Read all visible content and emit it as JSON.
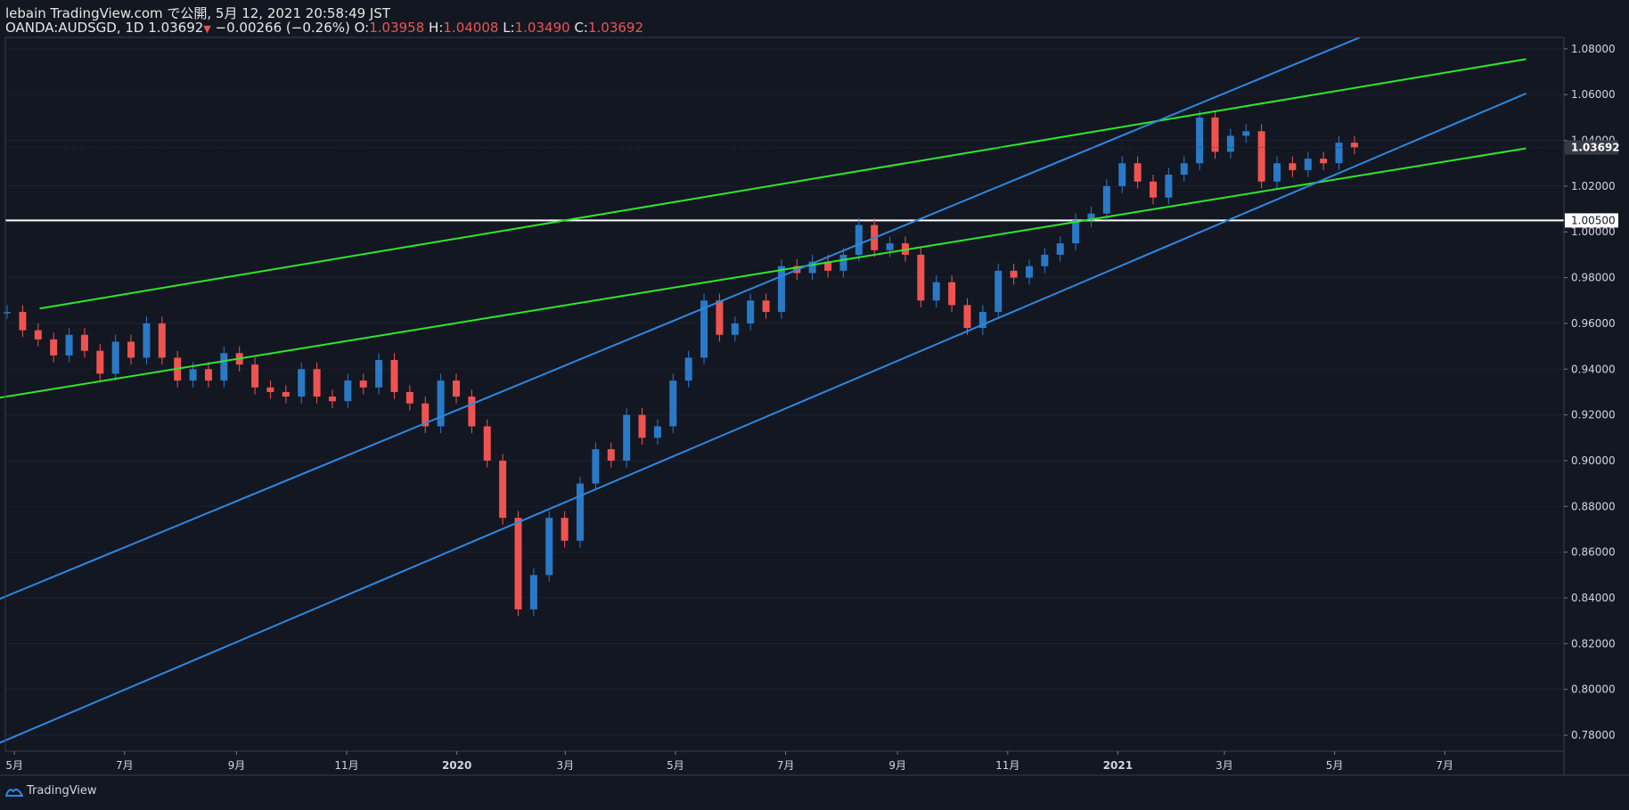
{
  "header": {
    "line1": "lebain TradingView.com で公開, 5月 12, 2021 20:58:49 JST",
    "symbol": "OANDA:AUDSGD, 1D",
    "last": "1.03692",
    "change": "−0.00266 (−0.26%)",
    "o_label": "O:",
    "o": "1.03958",
    "h_label": "H:",
    "h": "1.04008",
    "l_label": "L:",
    "l": "1.03490",
    "c_label": "C:",
    "c": "1.03692"
  },
  "footer": {
    "brand": "TradingView"
  },
  "chart_data": {
    "type": "candlestick",
    "y_axis": {
      "ticks": [
        "1.08000",
        "1.06000",
        "1.04000",
        "1.02000",
        "1.00000",
        "0.98000",
        "0.96000",
        "0.94000",
        "0.92000",
        "0.90000",
        "0.88000",
        "0.86000",
        "0.84000",
        "0.82000",
        "0.80000",
        "0.78000"
      ],
      "range": [
        0.773,
        1.085
      ]
    },
    "x_axis": {
      "ticks": [
        "5月",
        "7月",
        "9月",
        "11月",
        "2020",
        "3月",
        "5月",
        "7月",
        "9月",
        "11月",
        "2021",
        "3月",
        "5月",
        "7月"
      ]
    },
    "last_price": {
      "value": 1.03692,
      "label": "1.03692"
    },
    "horizontal_line": {
      "value": 1.005,
      "label": "1.00500"
    },
    "colors": {
      "up": "#2979c7",
      "down": "#ef5350",
      "trend_green": "#2ee82a",
      "trend_blue": "#2d88e0",
      "hline": "#ffffff"
    },
    "series": [
      {
        "t": "2019-05",
        "v": 0.965
      },
      {
        "t": "2019-05",
        "v": 0.957
      },
      {
        "t": "2019-06",
        "v": 0.953
      },
      {
        "t": "2019-06",
        "v": 0.946
      },
      {
        "t": "2019-06",
        "v": 0.955
      },
      {
        "t": "2019-07",
        "v": 0.948
      },
      {
        "t": "2019-07",
        "v": 0.938
      },
      {
        "t": "2019-07",
        "v": 0.952
      },
      {
        "t": "2019-07",
        "v": 0.945
      },
      {
        "t": "2019-08",
        "v": 0.96
      },
      {
        "t": "2019-08",
        "v": 0.945
      },
      {
        "t": "2019-08",
        "v": 0.935
      },
      {
        "t": "2019-08",
        "v": 0.94
      },
      {
        "t": "2019-09",
        "v": 0.935
      },
      {
        "t": "2019-09",
        "v": 0.947
      },
      {
        "t": "2019-09",
        "v": 0.942
      },
      {
        "t": "2019-10",
        "v": 0.932
      },
      {
        "t": "2019-10",
        "v": 0.93
      },
      {
        "t": "2019-10",
        "v": 0.928
      },
      {
        "t": "2019-11",
        "v": 0.94
      },
      {
        "t": "2019-11",
        "v": 0.928
      },
      {
        "t": "2019-11",
        "v": 0.926
      },
      {
        "t": "2019-12",
        "v": 0.935
      },
      {
        "t": "2019-12",
        "v": 0.932
      },
      {
        "t": "2020-01",
        "v": 0.944
      },
      {
        "t": "2020-01",
        "v": 0.93
      },
      {
        "t": "2020-01",
        "v": 0.925
      },
      {
        "t": "2020-02",
        "v": 0.915
      },
      {
        "t": "2020-02",
        "v": 0.935
      },
      {
        "t": "2020-02",
        "v": 0.928
      },
      {
        "t": "2020-03",
        "v": 0.915
      },
      {
        "t": "2020-03",
        "v": 0.9
      },
      {
        "t": "2020-03",
        "v": 0.875
      },
      {
        "t": "2020-03",
        "v": 0.835
      },
      {
        "t": "2020-03",
        "v": 0.85
      },
      {
        "t": "2020-04",
        "v": 0.875
      },
      {
        "t": "2020-04",
        "v": 0.865
      },
      {
        "t": "2020-04",
        "v": 0.89
      },
      {
        "t": "2020-04",
        "v": 0.905
      },
      {
        "t": "2020-05",
        "v": 0.9
      },
      {
        "t": "2020-05",
        "v": 0.92
      },
      {
        "t": "2020-05",
        "v": 0.91
      },
      {
        "t": "2020-05",
        "v": 0.915
      },
      {
        "t": "2020-06",
        "v": 0.935
      },
      {
        "t": "2020-06",
        "v": 0.945
      },
      {
        "t": "2020-06",
        "v": 0.97
      },
      {
        "t": "2020-06",
        "v": 0.955
      },
      {
        "t": "2020-07",
        "v": 0.96
      },
      {
        "t": "2020-07",
        "v": 0.97
      },
      {
        "t": "2020-07",
        "v": 0.965
      },
      {
        "t": "2020-07",
        "v": 0.985
      },
      {
        "t": "2020-08",
        "v": 0.982
      },
      {
        "t": "2020-08",
        "v": 0.987
      },
      {
        "t": "2020-08",
        "v": 0.983
      },
      {
        "t": "2020-08",
        "v": 0.99
      },
      {
        "t": "2020-09",
        "v": 1.003
      },
      {
        "t": "2020-09",
        "v": 0.992
      },
      {
        "t": "2020-09",
        "v": 0.995
      },
      {
        "t": "2020-09",
        "v": 0.99
      },
      {
        "t": "2020-10",
        "v": 0.97
      },
      {
        "t": "2020-10",
        "v": 0.978
      },
      {
        "t": "2020-10",
        "v": 0.968
      },
      {
        "t": "2020-10",
        "v": 0.958
      },
      {
        "t": "2020-11",
        "v": 0.965
      },
      {
        "t": "2020-11",
        "v": 0.983
      },
      {
        "t": "2020-11",
        "v": 0.98
      },
      {
        "t": "2020-11",
        "v": 0.985
      },
      {
        "t": "2020-12",
        "v": 0.99
      },
      {
        "t": "2020-12",
        "v": 0.995
      },
      {
        "t": "2020-12",
        "v": 1.005
      },
      {
        "t": "2020-12",
        "v": 1.008
      },
      {
        "t": "2021-01",
        "v": 1.02
      },
      {
        "t": "2021-01",
        "v": 1.03
      },
      {
        "t": "2021-01",
        "v": 1.022
      },
      {
        "t": "2021-01",
        "v": 1.015
      },
      {
        "t": "2021-02",
        "v": 1.025
      },
      {
        "t": "2021-02",
        "v": 1.03
      },
      {
        "t": "2021-02",
        "v": 1.05
      },
      {
        "t": "2021-03",
        "v": 1.035
      },
      {
        "t": "2021-03",
        "v": 1.042
      },
      {
        "t": "2021-03",
        "v": 1.044
      },
      {
        "t": "2021-04",
        "v": 1.022
      },
      {
        "t": "2021-04",
        "v": 1.03
      },
      {
        "t": "2021-04",
        "v": 1.027
      },
      {
        "t": "2021-04",
        "v": 1.032
      },
      {
        "t": "2021-05",
        "v": 1.03
      },
      {
        "t": "2021-05",
        "v": 1.039
      },
      {
        "t": "2021-05",
        "v": 1.03692
      }
    ],
    "trendlines": [
      {
        "color": "green",
        "from": {
          "t": "2019-05",
          "v": 0.9665
        },
        "to": {
          "t": "2021-08",
          "v": 1.0755
        }
      },
      {
        "color": "green",
        "from": {
          "t": "2019-04",
          "v": 0.9265
        },
        "to": {
          "t": "2021-08",
          "v": 1.0365
        }
      },
      {
        "color": "blue",
        "from": {
          "t": "2019-04",
          "v": 0.837
        },
        "to": {
          "t": "2021-05",
          "v": 1.085
        }
      },
      {
        "color": "blue",
        "from": {
          "t": "2019-04",
          "v": 0.774
        },
        "to": {
          "t": "2021-08",
          "v": 1.0605
        }
      }
    ]
  }
}
